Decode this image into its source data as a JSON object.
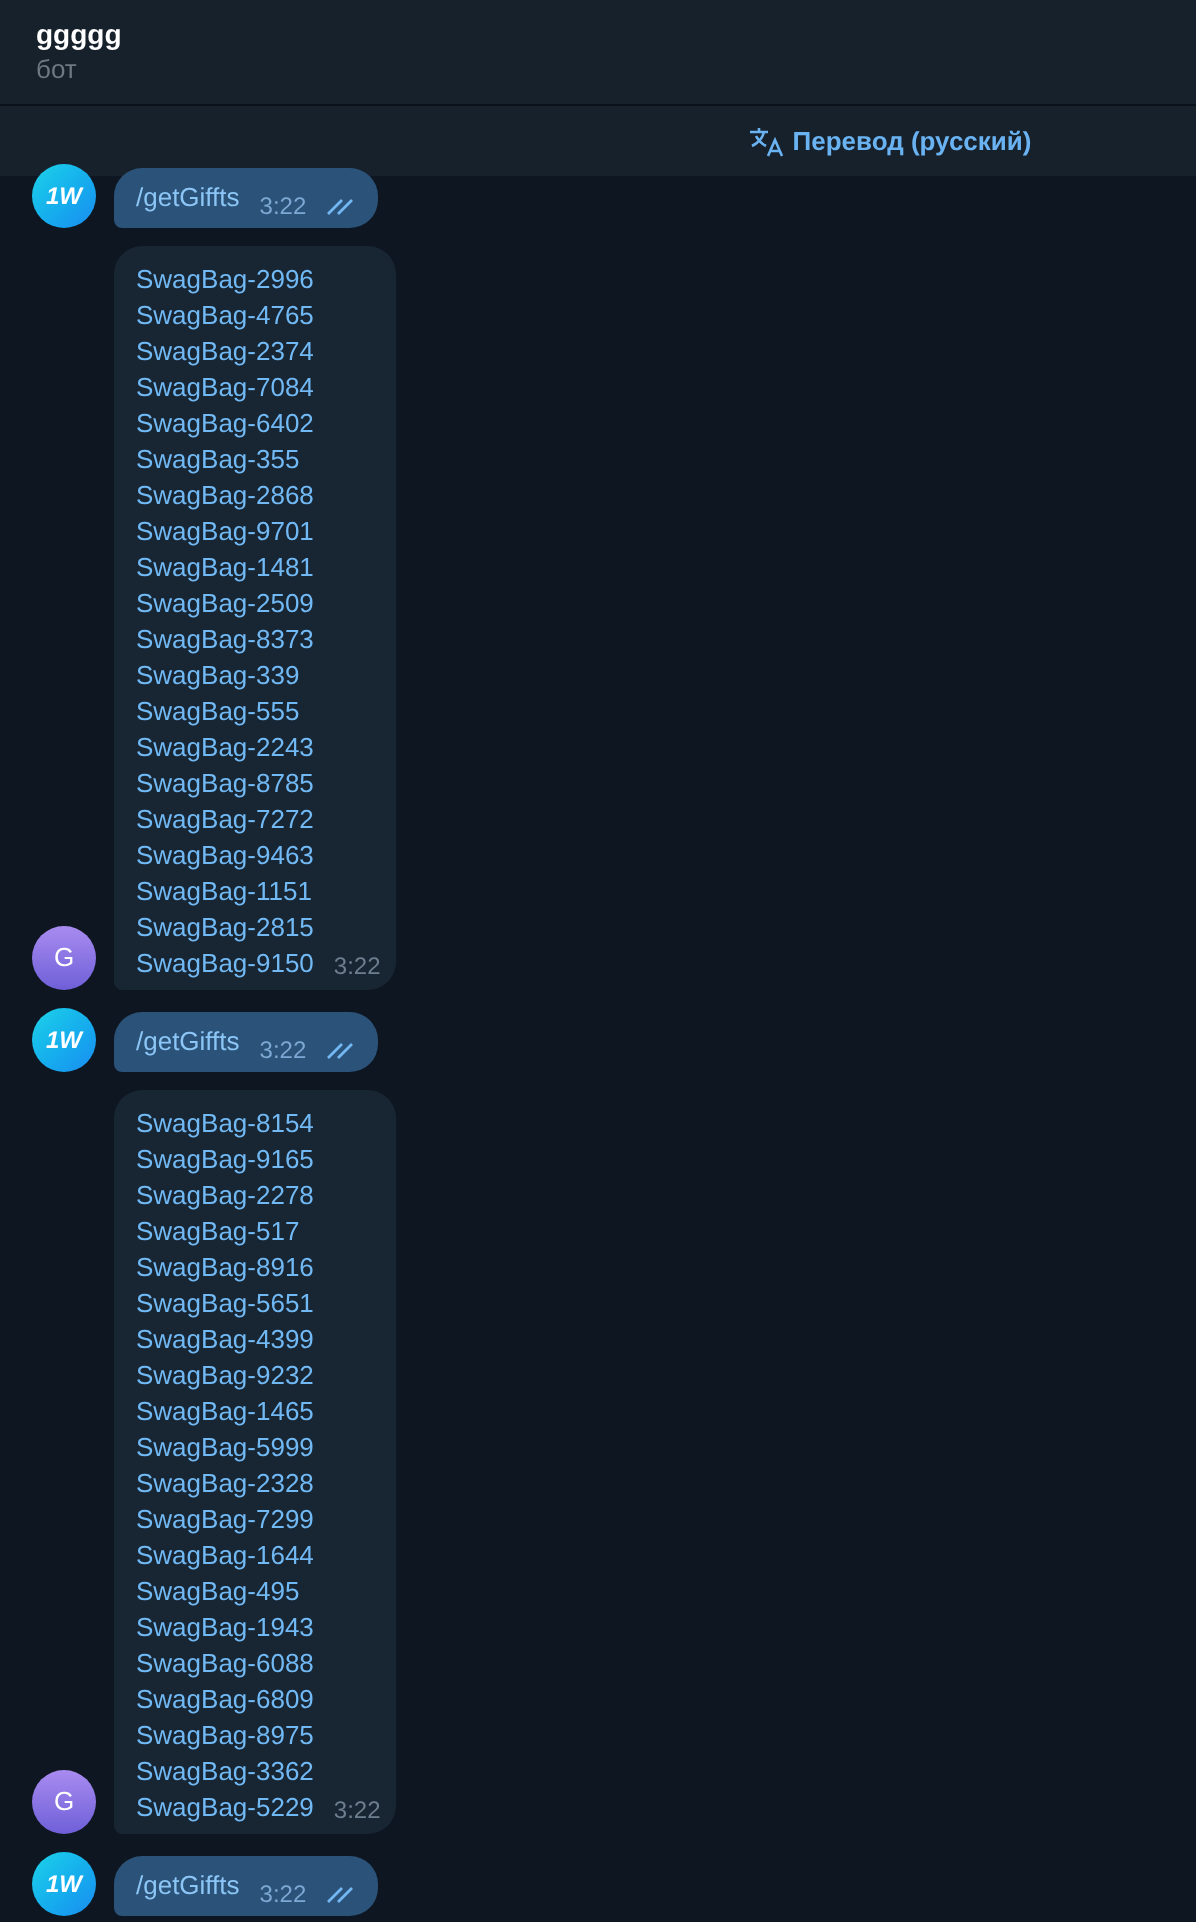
{
  "header": {
    "title": "ggggg",
    "subtitle": "бот"
  },
  "translate_bar": {
    "label": "Перевод (русский)"
  },
  "messages": [
    {
      "kind": "command",
      "avatar": "1W",
      "text": "/getGiffts",
      "time": "3:22",
      "read": true
    },
    {
      "kind": "list",
      "avatar": "G",
      "items": [
        "SwagBag-2996",
        "SwagBag-4765",
        "SwagBag-2374",
        "SwagBag-7084",
        "SwagBag-6402",
        "SwagBag-355",
        "SwagBag-2868",
        "SwagBag-9701",
        "SwagBag-1481",
        "SwagBag-2509",
        "SwagBag-8373",
        "SwagBag-339",
        "SwagBag-555",
        "SwagBag-2243",
        "SwagBag-8785",
        "SwagBag-7272",
        "SwagBag-9463",
        "SwagBag-1151",
        "SwagBag-2815",
        "SwagBag-9150"
      ],
      "time": "3:22"
    },
    {
      "kind": "command",
      "avatar": "1W",
      "text": "/getGiffts",
      "time": "3:22",
      "read": true
    },
    {
      "kind": "list",
      "avatar": "G",
      "items": [
        "SwagBag-8154",
        "SwagBag-9165",
        "SwagBag-2278",
        "SwagBag-517",
        "SwagBag-8916",
        "SwagBag-5651",
        "SwagBag-4399",
        "SwagBag-9232",
        "SwagBag-1465",
        "SwagBag-5999",
        "SwagBag-2328",
        "SwagBag-7299",
        "SwagBag-1644",
        "SwagBag-495",
        "SwagBag-1943",
        "SwagBag-6088",
        "SwagBag-6809",
        "SwagBag-8975",
        "SwagBag-3362",
        "SwagBag-5229"
      ],
      "time": "3:22"
    },
    {
      "kind": "command",
      "avatar": "1W",
      "text": "/getGiffts",
      "time": "3:22",
      "read": true
    }
  ]
}
